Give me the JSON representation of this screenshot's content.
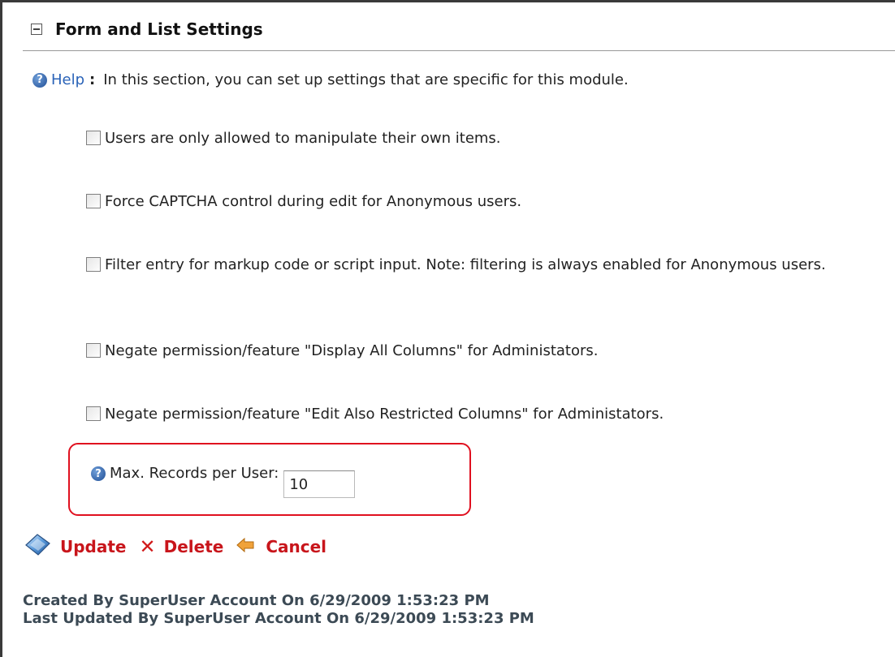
{
  "section": {
    "title": "Form and List Settings"
  },
  "help": {
    "link_label": "Help",
    "colon": ":",
    "text": "In this section, you can set up settings that are specific for this module."
  },
  "options": [
    {
      "label": "Users are only allowed to manipulate their own items.",
      "checked": false
    },
    {
      "label": "Force CAPTCHA control during edit for Anonymous users.",
      "checked": false
    },
    {
      "label": "Filter entry for markup code or script input. Note: filtering is always enabled for Anonymous users.",
      "checked": false
    },
    {
      "label": "Negate permission/feature \"Display All Columns\" for Administators.",
      "checked": false
    },
    {
      "label": "Negate permission/feature \"Edit Also Restricted Columns\" for Administators.",
      "checked": false
    }
  ],
  "max_records": {
    "label": "Max. Records per User:",
    "value": "10"
  },
  "actions": {
    "update": "Update",
    "delete": "Delete",
    "cancel": "Cancel"
  },
  "audit": {
    "created": "Created By SuperUser Account On 6/29/2009 1:53:23 PM",
    "updated": "Last Updated By SuperUser Account On 6/29/2009 1:53:23 PM"
  },
  "colors": {
    "action_red": "#c8151b",
    "highlight_red": "#e0101f",
    "link_blue": "#2a63b8",
    "help_icon_blue": "#1f4e96"
  },
  "icons": [
    "collapse-icon",
    "help-icon",
    "update-icon",
    "delete-icon",
    "cancel-icon"
  ]
}
